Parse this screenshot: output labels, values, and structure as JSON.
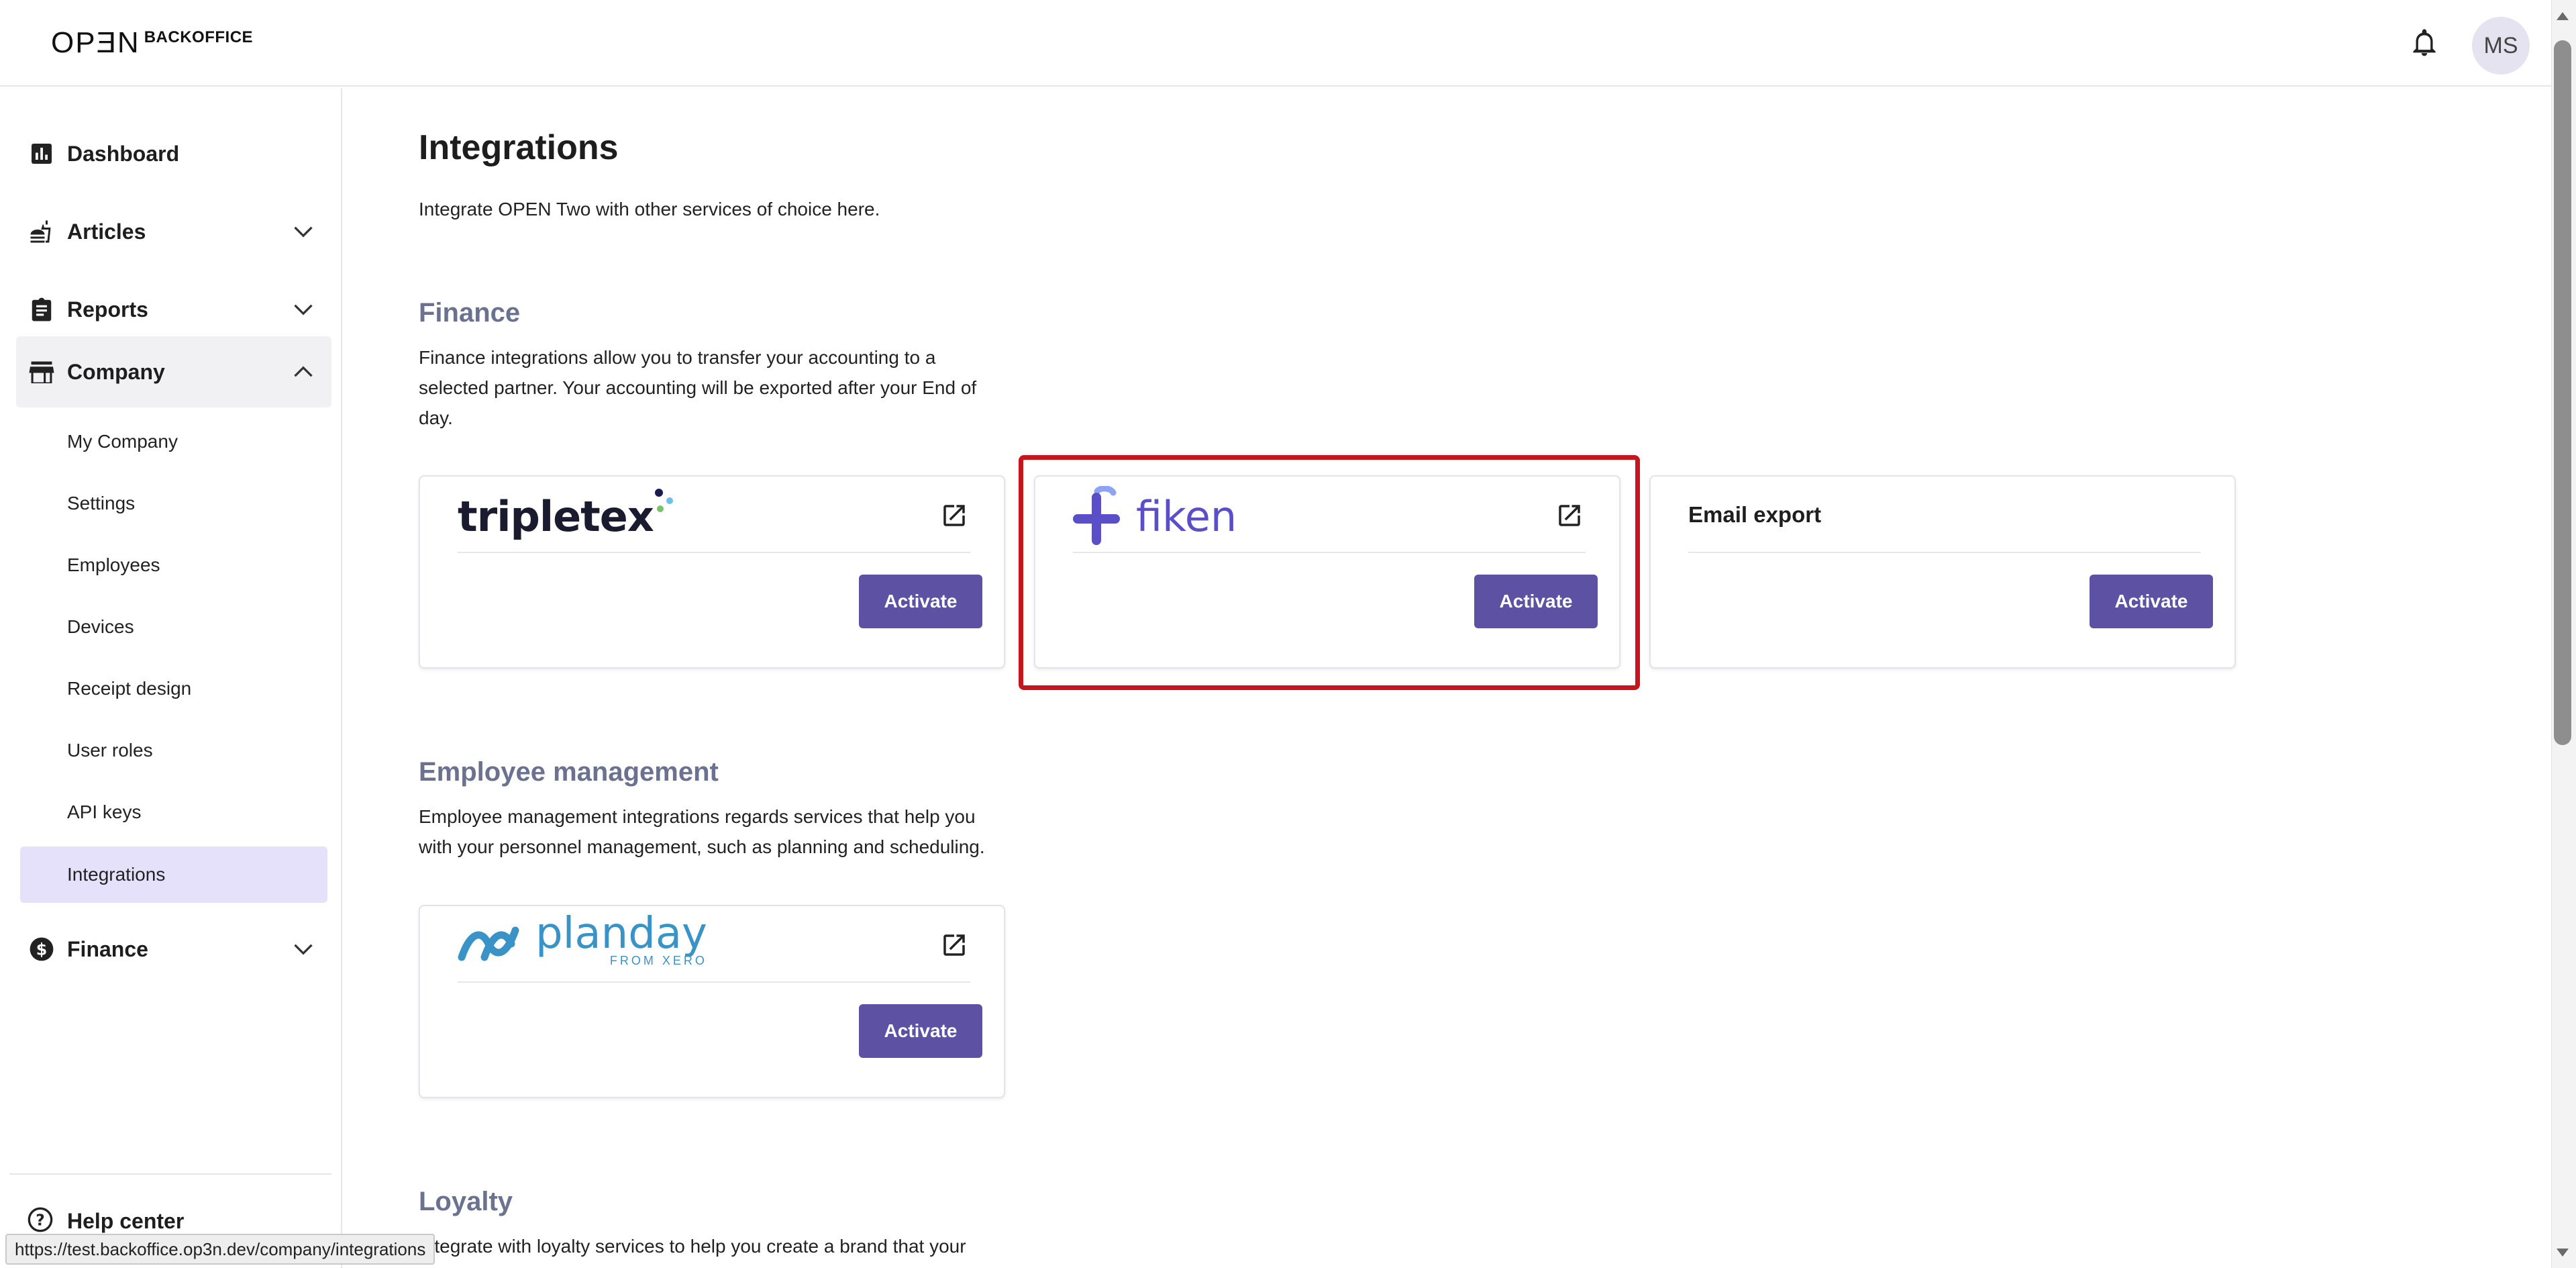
{
  "header": {
    "logo_mark": "OPƎN",
    "logo_text": "BACKOFFICE",
    "avatar_initials": "MS"
  },
  "sidebar": {
    "items": [
      {
        "label": "Dashboard"
      },
      {
        "label": "Articles"
      },
      {
        "label": "Reports"
      },
      {
        "label": "Company"
      },
      {
        "label": "Finance"
      }
    ],
    "company_sub": [
      {
        "label": "My Company"
      },
      {
        "label": "Settings"
      },
      {
        "label": "Employees"
      },
      {
        "label": "Devices"
      },
      {
        "label": "Receipt design"
      },
      {
        "label": "User roles"
      },
      {
        "label": "API keys"
      },
      {
        "label": "Integrations"
      }
    ],
    "help_label": "Help center"
  },
  "main": {
    "title": "Integrations",
    "description": "Integrate OPEN Two with other services of choice here.",
    "sections": [
      {
        "title": "Finance",
        "description": "Finance integrations allow you to transfer your accounting to a selected partner. Your accounting will be exported after your End of day.",
        "cards": [
          {
            "logo": "tripletex",
            "button": "Activate"
          },
          {
            "logo": "fiken",
            "button": "Activate"
          },
          {
            "title": "Email export",
            "button": "Activate"
          }
        ]
      },
      {
        "title": "Employee management",
        "description": "Employee management integrations regards services that help you with your personnel management, such as planning and scheduling.",
        "cards": [
          {
            "logo": "planday",
            "logo_sub": "FROM XERO",
            "button": "Activate"
          }
        ]
      },
      {
        "title": "Loyalty",
        "description": "Integrate with loyalty services to help you create a brand that your"
      }
    ]
  },
  "status_bar": {
    "url": "https://test.backoffice.op3n.dev/company/integrations"
  },
  "colors": {
    "accent": "#5d51a4",
    "active_nav": "#e6e1fa",
    "section_title": "#6b7290",
    "highlight": "#c4161c"
  }
}
